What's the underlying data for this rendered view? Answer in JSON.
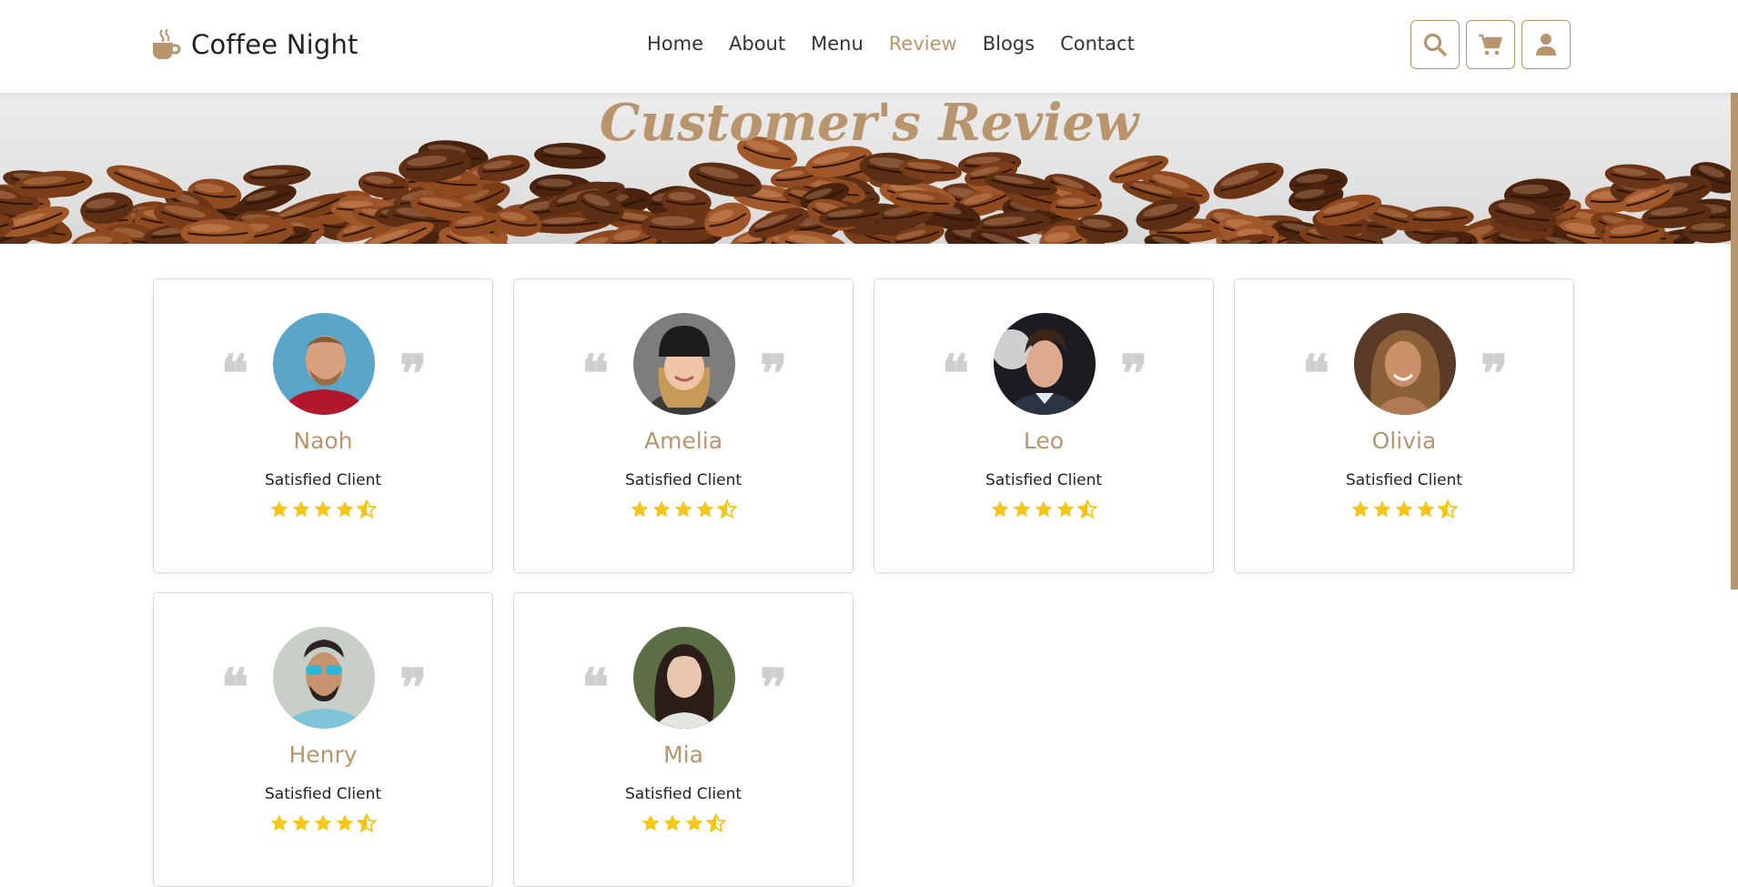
{
  "brand": {
    "name": "Coffee Night"
  },
  "nav": [
    {
      "label": "Home",
      "active": false
    },
    {
      "label": "About",
      "active": false
    },
    {
      "label": "Menu",
      "active": false
    },
    {
      "label": "Review",
      "active": true
    },
    {
      "label": "Blogs",
      "active": false
    },
    {
      "label": "Contact",
      "active": false
    }
  ],
  "actions": [
    {
      "icon": "search-icon"
    },
    {
      "icon": "cart-icon"
    },
    {
      "icon": "user-icon"
    }
  ],
  "hero": {
    "title": "Customer's Review"
  },
  "colors": {
    "accent": "#b9956d",
    "star": "#f5c518",
    "quote": "#cfcfcf"
  },
  "reviews": [
    {
      "name": "Naoh",
      "role": "Satisfied Client",
      "rating": 4.5
    },
    {
      "name": "Amelia",
      "role": "Satisfied Client",
      "rating": 4.5
    },
    {
      "name": "Leo",
      "role": "Satisfied Client",
      "rating": 4.5
    },
    {
      "name": "Olivia",
      "role": "Satisfied Client",
      "rating": 4.5
    },
    {
      "name": "Henry",
      "role": "Satisfied Client",
      "rating": 4.5
    },
    {
      "name": "Mia",
      "role": "Satisfied Client",
      "rating": 3.5
    }
  ]
}
